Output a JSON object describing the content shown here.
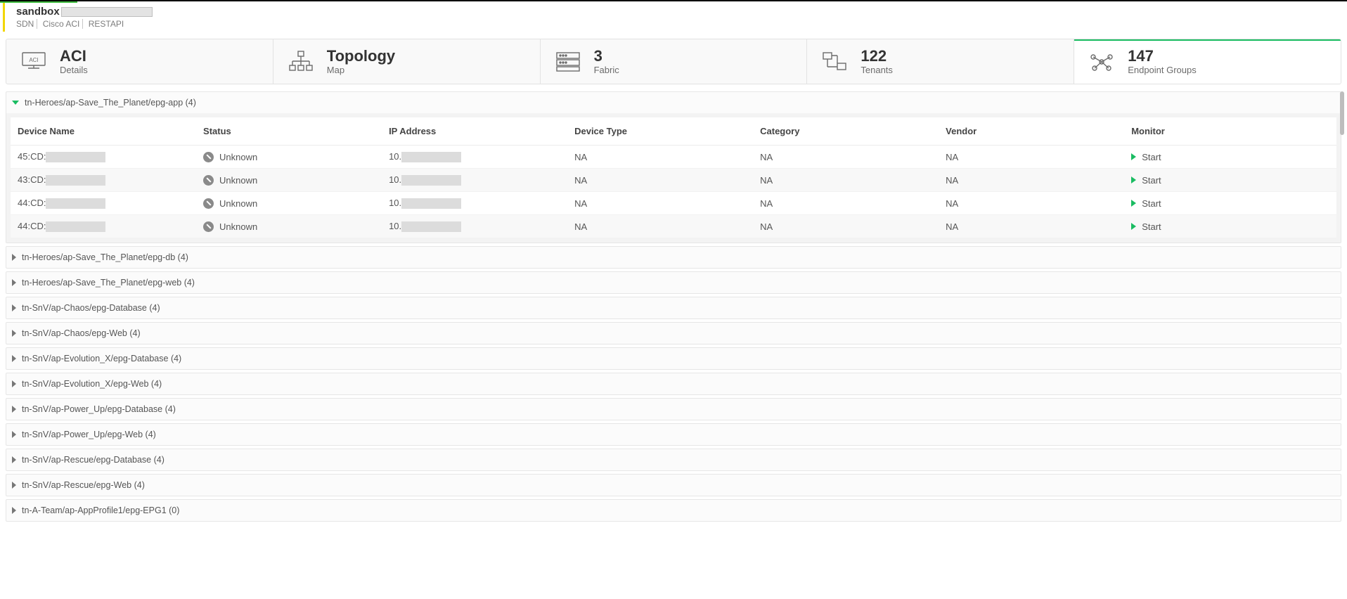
{
  "header": {
    "title": "sandbox",
    "breadcrumbs": [
      "SDN",
      "Cisco ACI",
      "RESTAPI"
    ]
  },
  "tabs": [
    {
      "title": "ACI",
      "subtitle": "Details",
      "kind": "aci"
    },
    {
      "title": "Topology",
      "subtitle": "Map",
      "kind": "topology"
    },
    {
      "title": "3",
      "subtitle": "Fabric",
      "kind": "fabric"
    },
    {
      "title": "122",
      "subtitle": "Tenants",
      "kind": "tenants"
    },
    {
      "title": "147",
      "subtitle": "Endpoint Groups",
      "kind": "epg",
      "active": true
    }
  ],
  "columns": [
    "Device Name",
    "Status",
    "IP Address",
    "Device Type",
    "Category",
    "Vendor",
    "Monitor"
  ],
  "expanded_section": {
    "label": "tn-Heroes/ap-Save_The_Planet/epg-app (4)",
    "rows": [
      {
        "device_prefix": "45:CD:",
        "status": "Unknown",
        "ip_prefix": "10.",
        "device_type": "NA",
        "category": "NA",
        "vendor": "NA",
        "monitor": "Start"
      },
      {
        "device_prefix": "43:CD:",
        "status": "Unknown",
        "ip_prefix": "10.",
        "device_type": "NA",
        "category": "NA",
        "vendor": "NA",
        "monitor": "Start"
      },
      {
        "device_prefix": "44:CD:",
        "status": "Unknown",
        "ip_prefix": "10.",
        "device_type": "NA",
        "category": "NA",
        "vendor": "NA",
        "monitor": "Start"
      },
      {
        "device_prefix": "44:CD:",
        "status": "Unknown",
        "ip_prefix": "10.",
        "device_type": "NA",
        "category": "NA",
        "vendor": "NA",
        "monitor": "Start"
      }
    ]
  },
  "collapsed_sections": [
    "tn-Heroes/ap-Save_The_Planet/epg-db (4)",
    "tn-Heroes/ap-Save_The_Planet/epg-web (4)",
    "tn-SnV/ap-Chaos/epg-Database (4)",
    "tn-SnV/ap-Chaos/epg-Web (4)",
    "tn-SnV/ap-Evolution_X/epg-Database (4)",
    "tn-SnV/ap-Evolution_X/epg-Web (4)",
    "tn-SnV/ap-Power_Up/epg-Database (4)",
    "tn-SnV/ap-Power_Up/epg-Web (4)",
    "tn-SnV/ap-Rescue/epg-Database (4)",
    "tn-SnV/ap-Rescue/epg-Web (4)",
    "tn-A-Team/ap-AppProfile1/epg-EPG1 (0)"
  ]
}
